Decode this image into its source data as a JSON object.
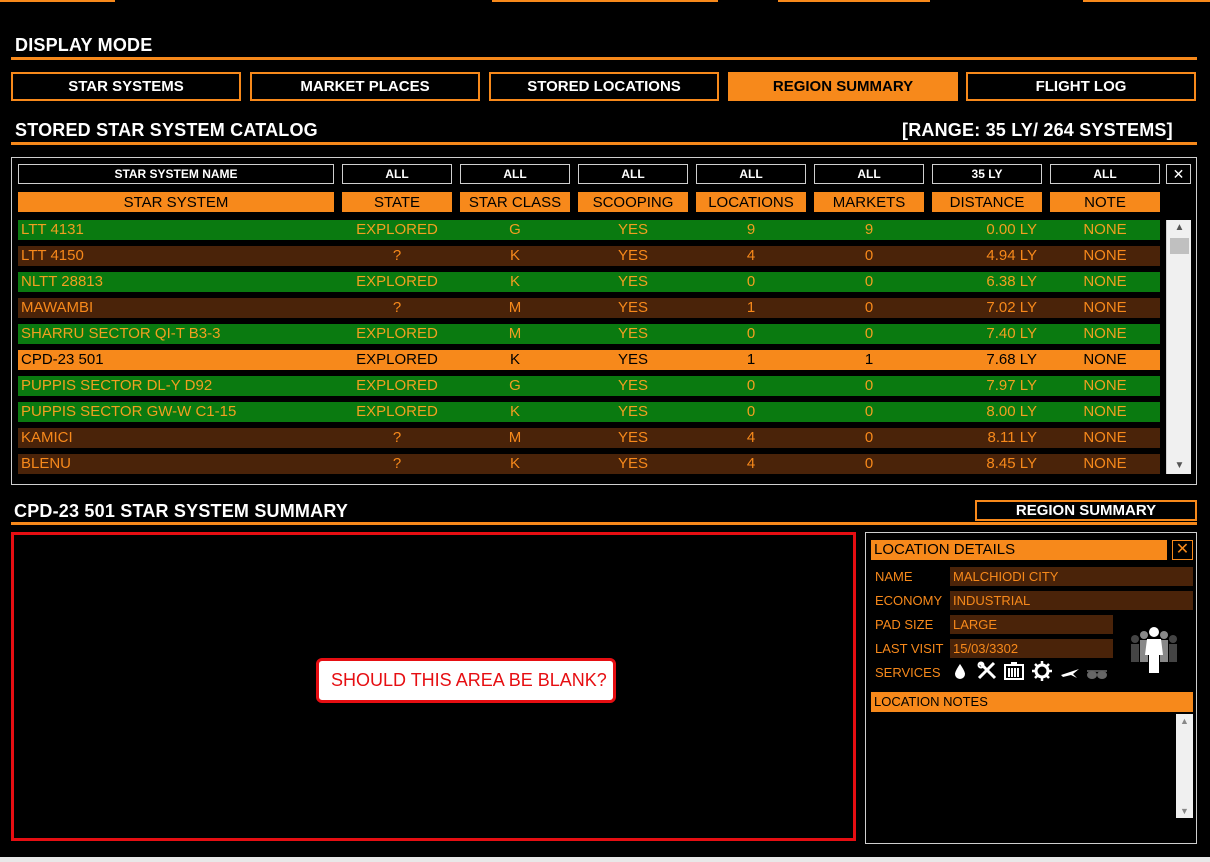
{
  "display_mode": {
    "title": "DISPLAY MODE",
    "tabs": [
      {
        "label": "STAR SYSTEMS",
        "active": false
      },
      {
        "label": "MARKET PLACES",
        "active": false
      },
      {
        "label": "STORED LOCATIONS",
        "active": false
      },
      {
        "label": "REGION SUMMARY",
        "active": true
      },
      {
        "label": "FLIGHT LOG",
        "active": false
      }
    ]
  },
  "catalog": {
    "title": "STORED STAR SYSTEM CATALOG",
    "range": "[RANGE: 35 LY/ 264 SYSTEMS]",
    "filters": [
      "STAR SYSTEM NAME",
      "ALL",
      "ALL",
      "ALL",
      "ALL",
      "ALL",
      "35 LY",
      "ALL"
    ],
    "clear_filter": "✕",
    "columns": [
      "STAR SYSTEM",
      "STATE",
      "STAR CLASS",
      "SCOOPING",
      "LOCATIONS",
      "MARKETS",
      "DISTANCE",
      "NOTE"
    ],
    "rows": [
      {
        "name": "LTT 4131",
        "state": "EXPLORED",
        "class": "G",
        "scooping": "YES",
        "locations": "9",
        "markets": "9",
        "distance": "0.00 LY",
        "note": "NONE",
        "style": "green"
      },
      {
        "name": "LTT 4150",
        "state": "?",
        "class": "K",
        "scooping": "YES",
        "locations": "4",
        "markets": "0",
        "distance": "4.94 LY",
        "note": "NONE",
        "style": "brown"
      },
      {
        "name": "NLTT 28813",
        "state": "EXPLORED",
        "class": "K",
        "scooping": "YES",
        "locations": "0",
        "markets": "0",
        "distance": "6.38 LY",
        "note": "NONE",
        "style": "green"
      },
      {
        "name": "MAWAMBI",
        "state": "?",
        "class": "M",
        "scooping": "YES",
        "locations": "1",
        "markets": "0",
        "distance": "7.02 LY",
        "note": "NONE",
        "style": "brown"
      },
      {
        "name": "SHARRU SECTOR QI-T B3-3",
        "state": "EXPLORED",
        "class": "M",
        "scooping": "YES",
        "locations": "0",
        "markets": "0",
        "distance": "7.40 LY",
        "note": "NONE",
        "style": "green"
      },
      {
        "name": "CPD-23 501",
        "state": "EXPLORED",
        "class": "K",
        "scooping": "YES",
        "locations": "1",
        "markets": "1",
        "distance": "7.68 LY",
        "note": "NONE",
        "style": "sel"
      },
      {
        "name": "PUPPIS SECTOR DL-Y D92",
        "state": "EXPLORED",
        "class": "G",
        "scooping": "YES",
        "locations": "0",
        "markets": "0",
        "distance": "7.97 LY",
        "note": "NONE",
        "style": "green"
      },
      {
        "name": "PUPPIS SECTOR GW-W C1-15",
        "state": "EXPLORED",
        "class": "K",
        "scooping": "YES",
        "locations": "0",
        "markets": "0",
        "distance": "8.00 LY",
        "note": "NONE",
        "style": "green"
      },
      {
        "name": "KAMICI",
        "state": "?",
        "class": "M",
        "scooping": "YES",
        "locations": "4",
        "markets": "0",
        "distance": "8.11 LY",
        "note": "NONE",
        "style": "brown"
      },
      {
        "name": "BLENU",
        "state": "?",
        "class": "K",
        "scooping": "YES",
        "locations": "4",
        "markets": "0",
        "distance": "8.45 LY",
        "note": "NONE",
        "style": "brown"
      }
    ]
  },
  "summary": {
    "title": "CPD-23 501 STAR SYSTEM SUMMARY",
    "region_button": "REGION SUMMARY",
    "callout": "SHOULD THIS AREA BE BLANK?"
  },
  "location_details": {
    "title": "LOCATION DETAILS",
    "close": "✕",
    "fields": [
      {
        "label": "NAME",
        "value": "MALCHIODI CITY"
      },
      {
        "label": "ECONOMY",
        "value": "INDUSTRIAL"
      },
      {
        "label": "PAD SIZE",
        "value": "LARGE"
      },
      {
        "label": "LAST VISIT",
        "value": "15/03/3302"
      }
    ],
    "services_label": "SERVICES",
    "services_icons": [
      "refuel-icon",
      "repair-icon",
      "rearm-icon",
      "outfitting-icon",
      "shipyard-icon",
      "blackmarket-icon"
    ],
    "notes_title": "LOCATION NOTES"
  },
  "colors": {
    "accent": "#f7891b",
    "explored_row": "#0a7a10",
    "unexplored_row": "#4a2309",
    "callout_red": "#e60e12"
  }
}
